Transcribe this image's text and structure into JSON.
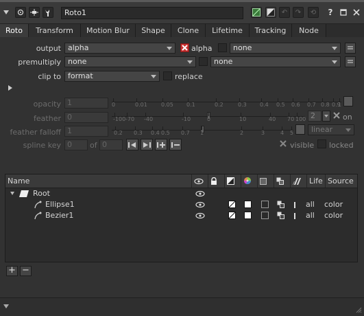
{
  "node": {
    "name": "Roto1"
  },
  "header_buttons": {
    "help": "?"
  },
  "tabs": [
    "Roto",
    "Transform",
    "Motion Blur",
    "Shape",
    "Clone",
    "Lifetime",
    "Tracking",
    "Node"
  ],
  "params": {
    "output_label": "output",
    "output_value": "alpha",
    "output_alpha_label": "alpha",
    "output_second": "none",
    "premultiply_label": "premultiply",
    "premultiply_value": "none",
    "premultiply_second": "none",
    "clipto_label": "clip to",
    "clipto_value": "format",
    "replace_label": "replace",
    "opacity_label": "opacity",
    "opacity_value": "1",
    "feather_label": "feather",
    "feather_value": "0",
    "feather_count": "2",
    "feather_on_label": "on",
    "feather_falloff_label": "feather falloff",
    "feather_falloff_value": "1",
    "feather_falloff_type": "linear",
    "spline_key_label": "spline key",
    "spline_key_value": "0",
    "spline_key_of": "of",
    "spline_key_total": "0",
    "visible_label": "visible",
    "locked_label": "locked"
  },
  "opacity_ticks": [
    "0",
    "0.01",
    "0.05",
    "0.1",
    "0.2",
    "0.3",
    "0.4",
    "0.5",
    "0.6",
    "0.7",
    "0.8",
    "0.9",
    "1"
  ],
  "feather_ticks": [
    "-100",
    "-70",
    "-40",
    "-10",
    "0",
    "10",
    "40",
    "70",
    "100"
  ],
  "falloff_ticks": [
    "0.2",
    "0.3",
    "0.4",
    "0.5",
    "0.7",
    "1",
    "2",
    "3",
    "4",
    "5"
  ],
  "layers_table": {
    "headers": {
      "name": "Name",
      "life": "Life",
      "source": "Source"
    },
    "rows": [
      {
        "name": "Root",
        "life": "",
        "source": ""
      },
      {
        "name": "Ellipse1",
        "life": "all",
        "source": "color"
      },
      {
        "name": "Bezier1",
        "life": "all",
        "source": "color"
      }
    ]
  },
  "list_buttons": {
    "add": "+",
    "remove": "−"
  },
  "colors": {
    "accent_green": "#4a8a3a",
    "alpha_red": "#c83030",
    "bg": "#323232"
  }
}
